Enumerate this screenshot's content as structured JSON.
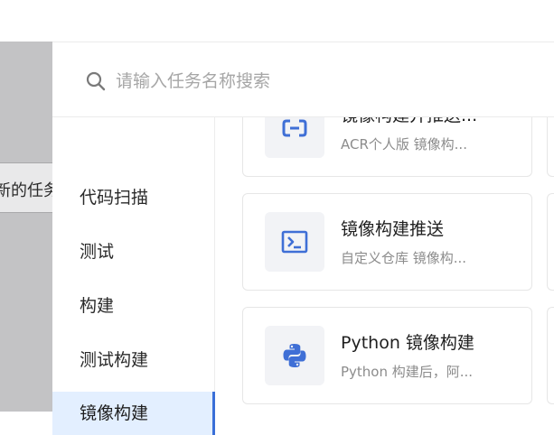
{
  "background": {
    "partial_tab_label": "新的任务"
  },
  "search": {
    "placeholder": "请输入任务名称搜索",
    "value": ""
  },
  "sidebar": {
    "items": [
      {
        "label": "代码扫描"
      },
      {
        "label": "测试"
      },
      {
        "label": "构建"
      },
      {
        "label": "测试构建"
      },
      {
        "label": "镜像构建"
      }
    ],
    "active_label": "镜像构建"
  },
  "cards": [
    {
      "title": "镜像构建并推送...",
      "desc": "ACR个人版 镜像构...",
      "icon": "acr-cloud-icon"
    },
    {
      "title": "镜像构建推送",
      "desc": "自定义仓库 镜像构...",
      "icon": "terminal-icon"
    },
    {
      "title": "Python 镜像构建",
      "desc": "Python 构建后，阿...",
      "icon": "python-icon"
    }
  ],
  "colors": {
    "accent": "#3a6fd8",
    "active_bg": "#e3efff",
    "icon_blue": "#3f6fd6",
    "backdrop": "#c3c3c5"
  }
}
